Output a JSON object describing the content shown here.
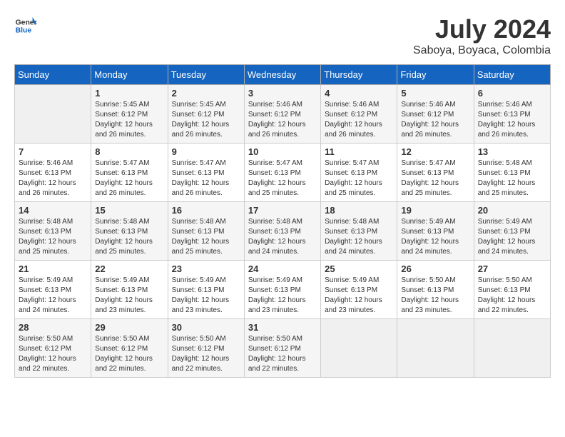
{
  "header": {
    "logo_line1": "General",
    "logo_line2": "Blue",
    "title": "July 2024",
    "subtitle": "Saboya, Boyaca, Colombia"
  },
  "weekdays": [
    "Sunday",
    "Monday",
    "Tuesday",
    "Wednesday",
    "Thursday",
    "Friday",
    "Saturday"
  ],
  "weeks": [
    [
      {
        "day": "",
        "info": ""
      },
      {
        "day": "1",
        "info": "Sunrise: 5:45 AM\nSunset: 6:12 PM\nDaylight: 12 hours\nand 26 minutes."
      },
      {
        "day": "2",
        "info": "Sunrise: 5:45 AM\nSunset: 6:12 PM\nDaylight: 12 hours\nand 26 minutes."
      },
      {
        "day": "3",
        "info": "Sunrise: 5:46 AM\nSunset: 6:12 PM\nDaylight: 12 hours\nand 26 minutes."
      },
      {
        "day": "4",
        "info": "Sunrise: 5:46 AM\nSunset: 6:12 PM\nDaylight: 12 hours\nand 26 minutes."
      },
      {
        "day": "5",
        "info": "Sunrise: 5:46 AM\nSunset: 6:12 PM\nDaylight: 12 hours\nand 26 minutes."
      },
      {
        "day": "6",
        "info": "Sunrise: 5:46 AM\nSunset: 6:13 PM\nDaylight: 12 hours\nand 26 minutes."
      }
    ],
    [
      {
        "day": "7",
        "info": "Sunrise: 5:46 AM\nSunset: 6:13 PM\nDaylight: 12 hours\nand 26 minutes."
      },
      {
        "day": "8",
        "info": "Sunrise: 5:47 AM\nSunset: 6:13 PM\nDaylight: 12 hours\nand 26 minutes."
      },
      {
        "day": "9",
        "info": "Sunrise: 5:47 AM\nSunset: 6:13 PM\nDaylight: 12 hours\nand 26 minutes."
      },
      {
        "day": "10",
        "info": "Sunrise: 5:47 AM\nSunset: 6:13 PM\nDaylight: 12 hours\nand 25 minutes."
      },
      {
        "day": "11",
        "info": "Sunrise: 5:47 AM\nSunset: 6:13 PM\nDaylight: 12 hours\nand 25 minutes."
      },
      {
        "day": "12",
        "info": "Sunrise: 5:47 AM\nSunset: 6:13 PM\nDaylight: 12 hours\nand 25 minutes."
      },
      {
        "day": "13",
        "info": "Sunrise: 5:48 AM\nSunset: 6:13 PM\nDaylight: 12 hours\nand 25 minutes."
      }
    ],
    [
      {
        "day": "14",
        "info": "Sunrise: 5:48 AM\nSunset: 6:13 PM\nDaylight: 12 hours\nand 25 minutes."
      },
      {
        "day": "15",
        "info": "Sunrise: 5:48 AM\nSunset: 6:13 PM\nDaylight: 12 hours\nand 25 minutes."
      },
      {
        "day": "16",
        "info": "Sunrise: 5:48 AM\nSunset: 6:13 PM\nDaylight: 12 hours\nand 25 minutes."
      },
      {
        "day": "17",
        "info": "Sunrise: 5:48 AM\nSunset: 6:13 PM\nDaylight: 12 hours\nand 24 minutes."
      },
      {
        "day": "18",
        "info": "Sunrise: 5:48 AM\nSunset: 6:13 PM\nDaylight: 12 hours\nand 24 minutes."
      },
      {
        "day": "19",
        "info": "Sunrise: 5:49 AM\nSunset: 6:13 PM\nDaylight: 12 hours\nand 24 minutes."
      },
      {
        "day": "20",
        "info": "Sunrise: 5:49 AM\nSunset: 6:13 PM\nDaylight: 12 hours\nand 24 minutes."
      }
    ],
    [
      {
        "day": "21",
        "info": "Sunrise: 5:49 AM\nSunset: 6:13 PM\nDaylight: 12 hours\nand 24 minutes."
      },
      {
        "day": "22",
        "info": "Sunrise: 5:49 AM\nSunset: 6:13 PM\nDaylight: 12 hours\nand 23 minutes."
      },
      {
        "day": "23",
        "info": "Sunrise: 5:49 AM\nSunset: 6:13 PM\nDaylight: 12 hours\nand 23 minutes."
      },
      {
        "day": "24",
        "info": "Sunrise: 5:49 AM\nSunset: 6:13 PM\nDaylight: 12 hours\nand 23 minutes."
      },
      {
        "day": "25",
        "info": "Sunrise: 5:49 AM\nSunset: 6:13 PM\nDaylight: 12 hours\nand 23 minutes."
      },
      {
        "day": "26",
        "info": "Sunrise: 5:50 AM\nSunset: 6:13 PM\nDaylight: 12 hours\nand 23 minutes."
      },
      {
        "day": "27",
        "info": "Sunrise: 5:50 AM\nSunset: 6:13 PM\nDaylight: 12 hours\nand 22 minutes."
      }
    ],
    [
      {
        "day": "28",
        "info": "Sunrise: 5:50 AM\nSunset: 6:12 PM\nDaylight: 12 hours\nand 22 minutes."
      },
      {
        "day": "29",
        "info": "Sunrise: 5:50 AM\nSunset: 6:12 PM\nDaylight: 12 hours\nand 22 minutes."
      },
      {
        "day": "30",
        "info": "Sunrise: 5:50 AM\nSunset: 6:12 PM\nDaylight: 12 hours\nand 22 minutes."
      },
      {
        "day": "31",
        "info": "Sunrise: 5:50 AM\nSunset: 6:12 PM\nDaylight: 12 hours\nand 22 minutes."
      },
      {
        "day": "",
        "info": ""
      },
      {
        "day": "",
        "info": ""
      },
      {
        "day": "",
        "info": ""
      }
    ]
  ]
}
